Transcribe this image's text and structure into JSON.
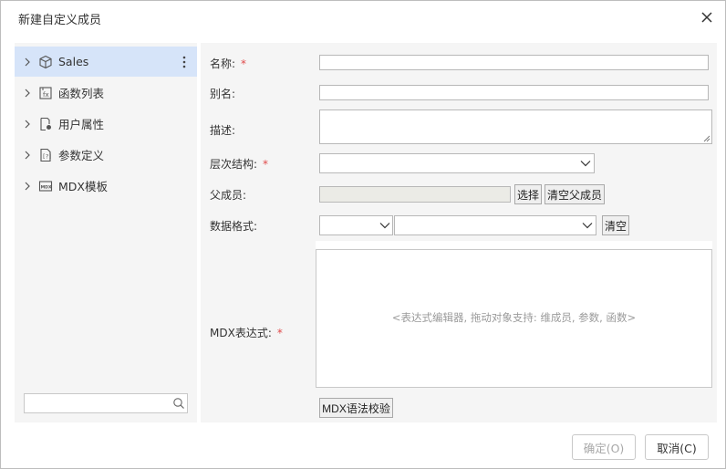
{
  "dialog": {
    "title": "新建自定义成员"
  },
  "tree": {
    "items": [
      {
        "label": "Sales",
        "icon": "cube-icon",
        "selected": true
      },
      {
        "label": "函数列表",
        "icon": "function-icon",
        "selected": false
      },
      {
        "label": "用户属性",
        "icon": "user-property-icon",
        "selected": false
      },
      {
        "label": "参数定义",
        "icon": "parameter-icon",
        "selected": false
      },
      {
        "label": "MDX模板",
        "icon": "mdx-template-icon",
        "selected": false
      }
    ],
    "search": {
      "value": "",
      "placeholder": ""
    }
  },
  "form": {
    "name": {
      "label": "名称:",
      "required_mark": "*",
      "value": ""
    },
    "alias": {
      "label": "别名:",
      "value": ""
    },
    "description": {
      "label": "描述:",
      "value": ""
    },
    "hierarchy": {
      "label": "层次结构:",
      "required_mark": "*",
      "value": ""
    },
    "parent": {
      "label": "父成员:",
      "value": "",
      "select_label": "选择",
      "clear_label": "清空父成员"
    },
    "data_format": {
      "label": "数据格式:",
      "type_value": "",
      "format_value": "",
      "clear_label": "清空"
    },
    "mdx": {
      "label": "MDX表达式:",
      "required_mark": "*",
      "placeholder": "<表达式编辑器, 拖动对象支持: 维成员, 参数, 函数>",
      "validate_label": "MDX语法校验"
    }
  },
  "footer": {
    "ok_label": "确定(O)",
    "cancel_label": "取消(C)"
  },
  "colors": {
    "selected_bg": "#d6e4f9",
    "panel_bg": "#f5f5f5",
    "required": "#e04a4a"
  }
}
